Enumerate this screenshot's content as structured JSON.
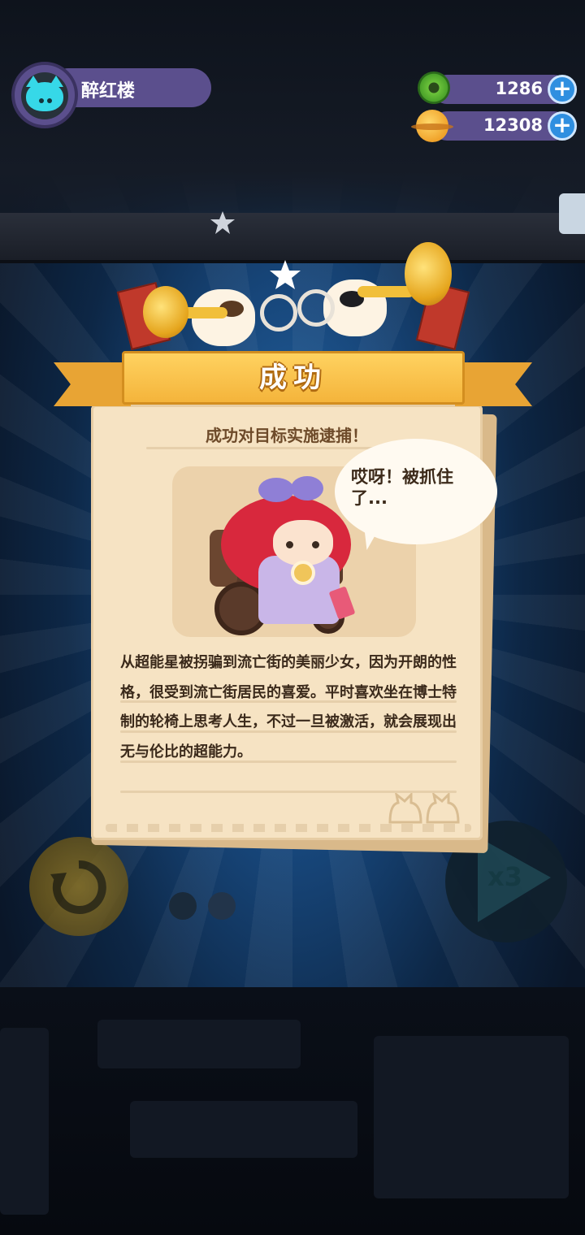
{
  "player": {
    "name": "醉红楼"
  },
  "currencies": [
    {
      "icon": "donut-coin-icon",
      "value": "1286"
    },
    {
      "icon": "planet-coin-icon",
      "value": "12308"
    }
  ],
  "plus_label": "+",
  "dialog": {
    "title": "成功",
    "subtitle": "成功对目标实施逮捕！",
    "speech": "哎呀！被抓住了...",
    "description": "从超能星被拐骗到流亡街的美丽少女，因为开朗的性格，很受到流亡街居民的喜爱。平时喜欢坐在博士特制的轮椅上思考人生，不过一旦被激活，就会展现出无与伦比的超能力。"
  },
  "controls": {
    "speed_label": "x3"
  },
  "colors": {
    "accent": "#5b4f8d",
    "ribbon": "#f4b43b",
    "paper": "#f6e3c3",
    "plus": "#2f8fe0"
  }
}
